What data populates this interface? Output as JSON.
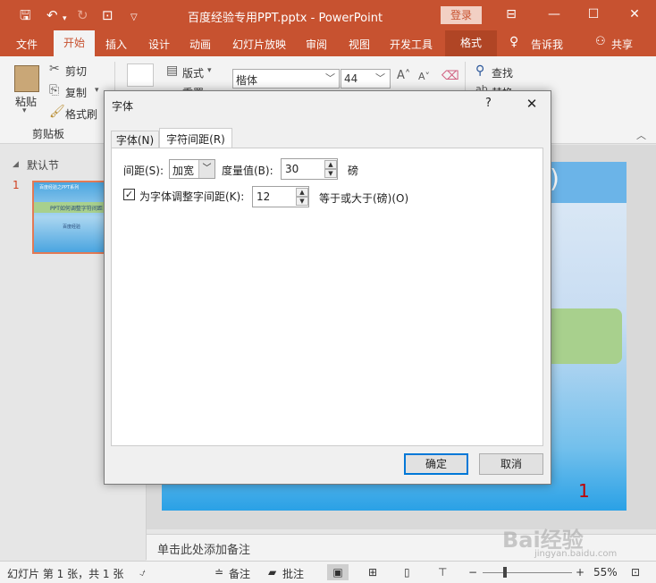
{
  "titlebar": {
    "doc_title": "百度经验专用PPT.pptx  -  PowerPoint",
    "login": "登录"
  },
  "tabs": {
    "file": "文件",
    "home": "开始",
    "insert": "插入",
    "design": "设计",
    "animation": "动画",
    "slideshow": "幻灯片放映",
    "review": "审阅",
    "view": "视图",
    "developer": "开发工具",
    "format": "格式",
    "tellme": "告诉我",
    "share": "共享"
  },
  "ribbon": {
    "paste": "粘贴",
    "cut": "剪切",
    "copy": "复制",
    "format_painter": "格式刷",
    "clipboard_group": "剪贴板",
    "layout": "版式",
    "reset": "重置",
    "font_name": "楷体",
    "font_size": "44",
    "find": "查找",
    "replace": "替换"
  },
  "leftpane": {
    "section": "默认节",
    "slide_number": "1",
    "thumb_title": "百度经验之PPT系列",
    "thumb_line": "PPT如何调整字符间距",
    "thumb_author": "百度经验"
  },
  "slide": {
    "number": "1",
    "paren": ")",
    "notes_placeholder": "单击此处添加备注"
  },
  "dialog": {
    "title": "字体",
    "help": "?",
    "tab_font": "字体(N)",
    "tab_spacing": "字符间距(R)",
    "spacing_label": "间距(S):",
    "spacing_value": "加宽",
    "measure_label": "度量值(B):",
    "measure_value": "30",
    "unit": "磅",
    "kerning_label": "为字体调整字间距(K):",
    "kerning_value": "12",
    "kerning_suffix": "等于或大于(磅)(O)",
    "ok": "确定",
    "cancel": "取消"
  },
  "statusbar": {
    "slide_info": "幻灯片 第 1 张，共 1 张",
    "notes": "备注",
    "comments": "批注",
    "zoom": "55%"
  },
  "watermark": {
    "brand": "Bai经验",
    "url": "jingyan.baidu.com"
  }
}
